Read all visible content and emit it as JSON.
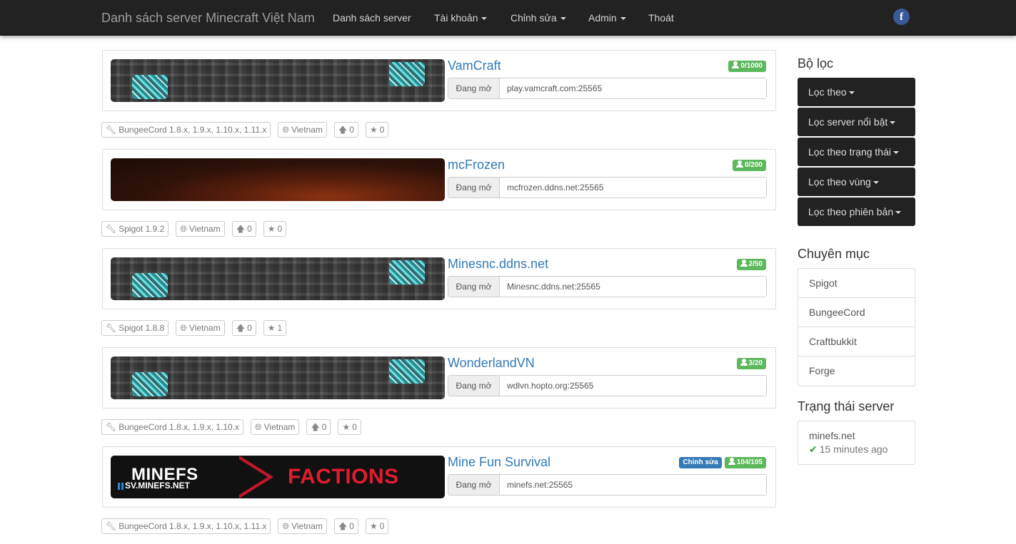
{
  "nav": {
    "brand": "Danh sách server Minecraft Việt Nam",
    "items": [
      {
        "label": "Danh sách server",
        "dropdown": false
      },
      {
        "label": "Tài khoản",
        "dropdown": true
      },
      {
        "label": "Chỉnh sửa",
        "dropdown": true
      },
      {
        "label": "Admin",
        "dropdown": true
      },
      {
        "label": "Thoát",
        "dropdown": false
      }
    ],
    "social_icon": "facebook-icon",
    "social_glyph": "f"
  },
  "servers": [
    {
      "name": "VamCraft",
      "players": "0/1000",
      "edit_label": "",
      "status_label": "Đang mở",
      "address": "play.vamcraft.com:25565",
      "banner": "diamond-ore",
      "tags": {
        "software": "BungeeCord 1.8.x, 1.9.x, 1.10.x, 1.11.x",
        "country": "Vietnam",
        "votes": "0",
        "stars": "0"
      }
    },
    {
      "name": "mcFrozen",
      "players": "0/200",
      "edit_label": "",
      "status_label": "Đang mở",
      "address": "mcfrozen.ddns.net:25565",
      "banner": "dark-gradient",
      "tags": {
        "software": "Spigot 1.9.2",
        "country": "Vietnam",
        "votes": "0",
        "stars": "0"
      }
    },
    {
      "name": "Minesnc.ddns.net",
      "players": "2/50",
      "edit_label": "",
      "status_label": "Đang mở",
      "address": "Minesnc.ddns.net:25565",
      "banner": "diamond-ore",
      "tags": {
        "software": "Spigot 1.8.8",
        "country": "Vietnam",
        "votes": "0",
        "stars": "1"
      }
    },
    {
      "name": "WonderlandVN",
      "players": "3/20",
      "edit_label": "",
      "status_label": "Đang mở",
      "address": "wdlvn.hopto.org:25565",
      "banner": "diamond-ore",
      "tags": {
        "software": "BungeeCord 1.8.x, 1.9.x, 1.10.x",
        "country": "Vietnam",
        "votes": "0",
        "stars": "0"
      }
    },
    {
      "name": "Mine Fun Survival",
      "players": "104/105",
      "edit_label": "Chỉnh sửa",
      "status_label": "Đang mở",
      "address": "minefs.net:25565",
      "banner": "minefs",
      "banner_text": {
        "logo": "MINEFS",
        "sub": "SV.MINEFS.NET",
        "title": "FACTIONS"
      },
      "tags": {
        "software": "BungeeCord 1.8.x, 1.9.x, 1.10.x, 1.11.x",
        "country": "Vietnam",
        "votes": "0",
        "stars": "0"
      }
    }
  ],
  "sidebar": {
    "filter_title": "Bộ lọc",
    "filters": [
      "Lọc theo",
      "Lọc server nổi bật",
      "Lọc theo trạng thái",
      "Lọc theo vùng",
      "Lọc theo phiên bản"
    ],
    "category_title": "Chuyên mục",
    "categories": [
      "Spigot",
      "BungeeCord",
      "Craftbukkit",
      "Forge"
    ],
    "status_title": "Trạng thái server",
    "status": {
      "server": "minefs.net",
      "time": "15 minutes ago"
    }
  },
  "colors": {
    "navbar": "#222222",
    "link": "#337ab7",
    "success": "#5cb85c",
    "primary": "#337ab7"
  }
}
